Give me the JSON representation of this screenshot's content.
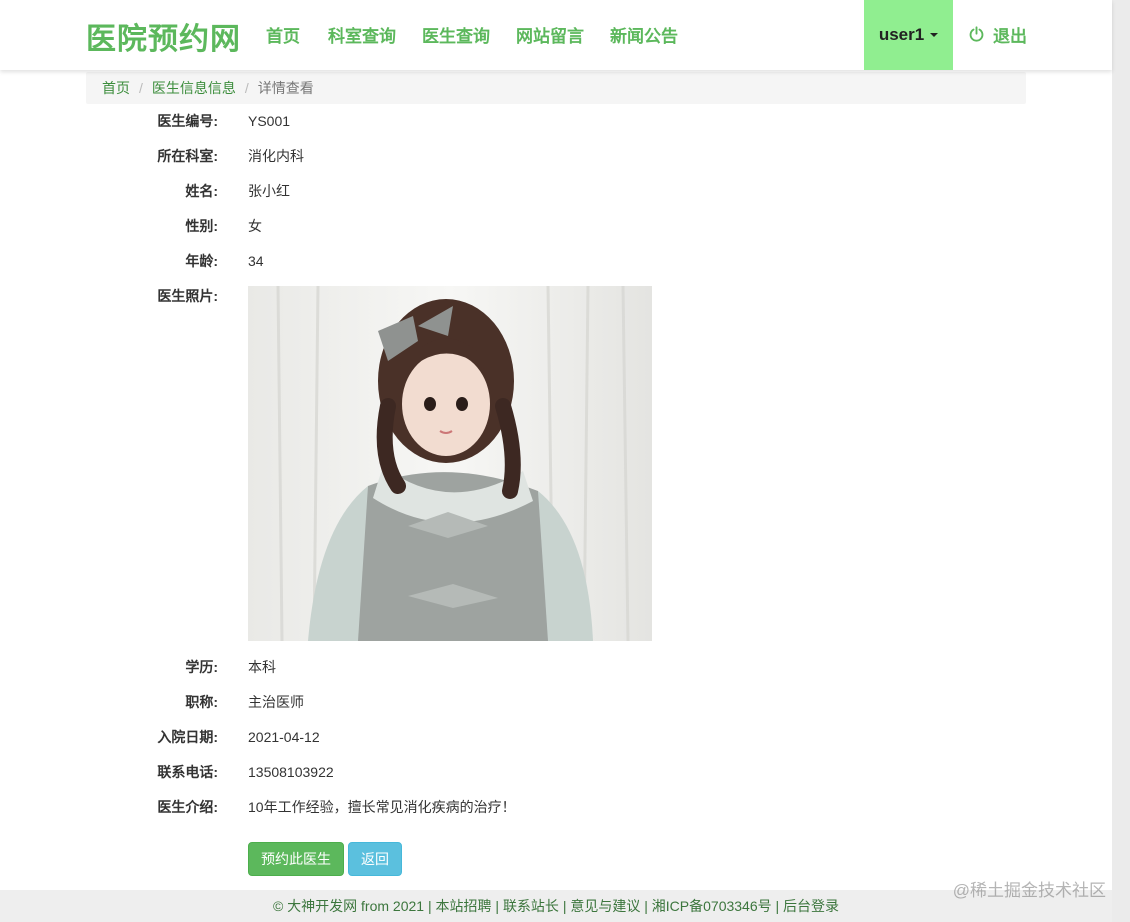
{
  "brand": "医院预约网",
  "nav": {
    "items": [
      {
        "label": "首页"
      },
      {
        "label": "科室查询"
      },
      {
        "label": "医生查询"
      },
      {
        "label": "网站留言"
      },
      {
        "label": "新闻公告"
      }
    ],
    "user_label": "user1",
    "logout_label": "退出"
  },
  "breadcrumb": {
    "home": "首页",
    "section": "医生信息信息",
    "current": "详情查看"
  },
  "details": {
    "doctor_id": {
      "label": "医生编号:",
      "value": "YS001"
    },
    "department": {
      "label": "所在科室:",
      "value": "消化内科"
    },
    "name": {
      "label": "姓名:",
      "value": "张小红"
    },
    "gender": {
      "label": "性别:",
      "value": "女"
    },
    "age": {
      "label": "年龄:",
      "value": "34"
    },
    "photo": {
      "label": "医生照片:"
    },
    "education": {
      "label": "学历:",
      "value": "本科"
    },
    "title": {
      "label": "职称:",
      "value": "主治医师"
    },
    "hire_date": {
      "label": "入院日期:",
      "value": "2021-04-12"
    },
    "phone": {
      "label": "联系电话:",
      "value": "13508103922"
    },
    "intro": {
      "label": "医生介绍:",
      "value": "10年工作经验，擅长常见消化疾病的治疗！"
    }
  },
  "buttons": {
    "book": "预约此医生",
    "back": "返回"
  },
  "footer": {
    "copyright": "© 大神开发网 from 2021",
    "links": [
      "本站招聘",
      "联系站长",
      "意见与建议",
      "湘ICP备0703346号",
      "后台登录"
    ]
  },
  "watermark": "@稀土掘金技术社区",
  "colors": {
    "brand_green": "#5cb85c",
    "user_menu_bg": "#90ee90",
    "info_blue": "#5bc0de"
  }
}
